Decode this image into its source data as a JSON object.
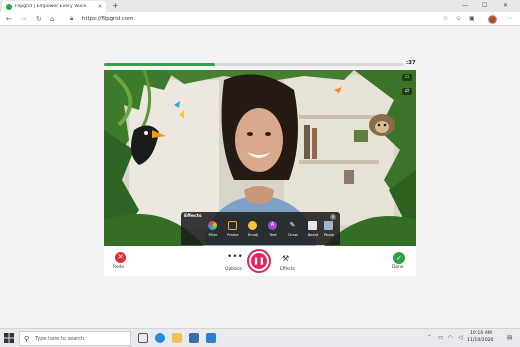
{
  "browser": {
    "tab_title": "Flipgrid | Empower Every Voice",
    "tab_close": "✕",
    "new_tab": "+",
    "url": "https://flipgrid.com",
    "window_controls": [
      "—",
      "☐",
      "✕"
    ]
  },
  "recorder": {
    "timer": ":37",
    "progress": 0.37,
    "accent_color": "#e2235e",
    "progress_color": "#29a84a"
  },
  "effects_panel": {
    "title": "Effects",
    "items": [
      {
        "label": "Filter",
        "color": "#6e5bd6"
      },
      {
        "label": "Frame",
        "color": "#f2a33a"
      },
      {
        "label": "Emoji",
        "color": "#f6c33b"
      },
      {
        "label": "Text",
        "color": "#a64bd6"
      },
      {
        "label": "Draw",
        "color": "#f0f0f0"
      },
      {
        "label": "Board",
        "color": "#e6e6e6"
      },
      {
        "label": "Photo",
        "color": "#9bb7cf"
      }
    ]
  },
  "controls": {
    "redo_label": "Redo",
    "options_label": "Options",
    "effects_label": "Effects",
    "done_label": "Done"
  },
  "taskbar": {
    "search_placeholder": "Type here to search",
    "time": "10:10 AM",
    "date": "11/10/2020"
  }
}
